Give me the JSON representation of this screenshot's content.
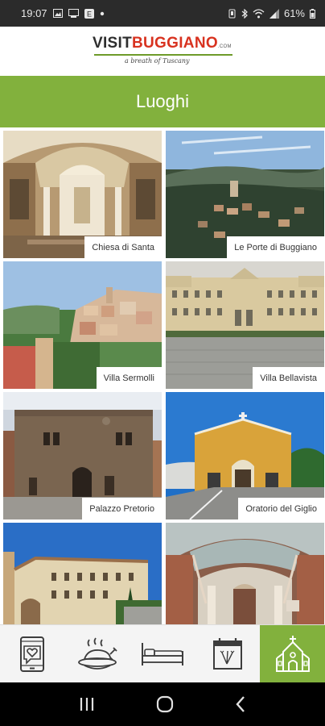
{
  "status_bar": {
    "time": "19:07",
    "battery": "61%"
  },
  "header": {
    "logo_visit": "VISIT",
    "logo_buggiano": "BUGGIANO",
    "logo_com": ".COM",
    "logo_tagline": "a breath of Tuscany"
  },
  "page": {
    "title": "Luoghi"
  },
  "places": [
    {
      "label": "Chiesa di Santa"
    },
    {
      "label": "Le Porte di Buggiano"
    },
    {
      "label": "Villa Sermolli"
    },
    {
      "label": "Villa Bellavista"
    },
    {
      "label": "Palazzo Pretorio"
    },
    {
      "label": "Oratorio del Giglio"
    },
    {
      "label": ""
    },
    {
      "label": ""
    }
  ],
  "bottom_nav": {
    "items": [
      {
        "icon": "phone-heart-icon"
      },
      {
        "icon": "food-platter-icon"
      },
      {
        "icon": "bed-icon"
      },
      {
        "icon": "calendar-icon"
      },
      {
        "icon": "church-icon",
        "active": true
      }
    ]
  },
  "colors": {
    "accent": "#82b13d",
    "brand_red": "#d8321f"
  }
}
